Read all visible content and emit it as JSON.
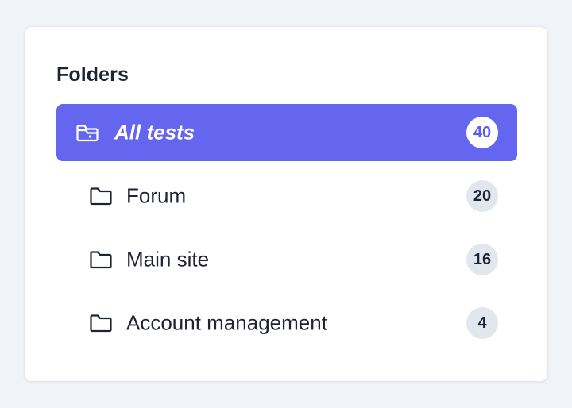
{
  "panel": {
    "title": "Folders"
  },
  "folders": [
    {
      "label": "All tests",
      "count": "40",
      "icon": "folder-open-icon",
      "active": true
    },
    {
      "label": "Forum",
      "count": "20",
      "icon": "folder-icon",
      "active": false
    },
    {
      "label": "Main site",
      "count": "16",
      "icon": "folder-icon",
      "active": false
    },
    {
      "label": "Account management",
      "count": "4",
      "icon": "folder-icon",
      "active": false
    }
  ],
  "colors": {
    "accent": "#6466ef",
    "background": "#f0f3f8",
    "card": "#ffffff",
    "text": "#1e2433",
    "badge": "#e2e7ef"
  }
}
